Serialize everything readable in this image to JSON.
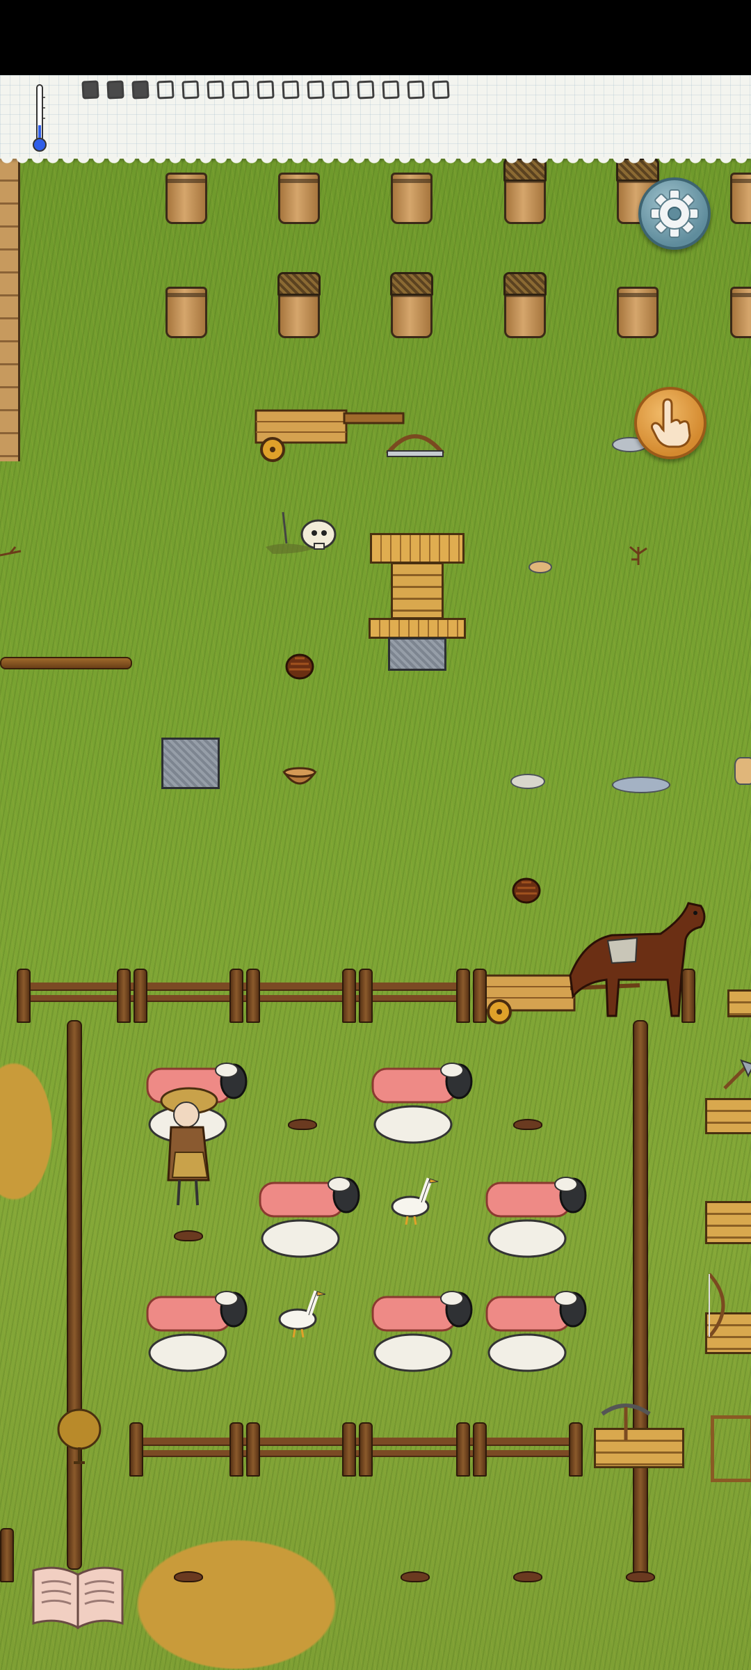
{
  "status_bar": {},
  "hud": {
    "thermometer_icon": "thermometer-icon",
    "food_meter": {
      "total_pips": 15,
      "filled_pips": 3
    }
  },
  "buttons": {
    "settings_icon": "gear-icon",
    "interact_icon": "hand-pointer-icon",
    "recipe_book_icon": "open-book-icon"
  },
  "world": {
    "ground": "grass",
    "colors": {
      "grass": "#7aa432",
      "dry_grass": "#c99b3a",
      "fence_wood": "#7b4a24",
      "thermometer_blue": "#2f5ee8"
    },
    "objects": [
      "baskets",
      "wooden-cart",
      "bow-saw",
      "skull",
      "wooden-well",
      "stone-block",
      "clay-bowl",
      "flat-stones",
      "long-shaft",
      "horse-cart",
      "sheep-pen",
      "domestic-sheep",
      "domestic-geese",
      "player-character",
      "crates",
      "pickaxe",
      "bow"
    ]
  }
}
